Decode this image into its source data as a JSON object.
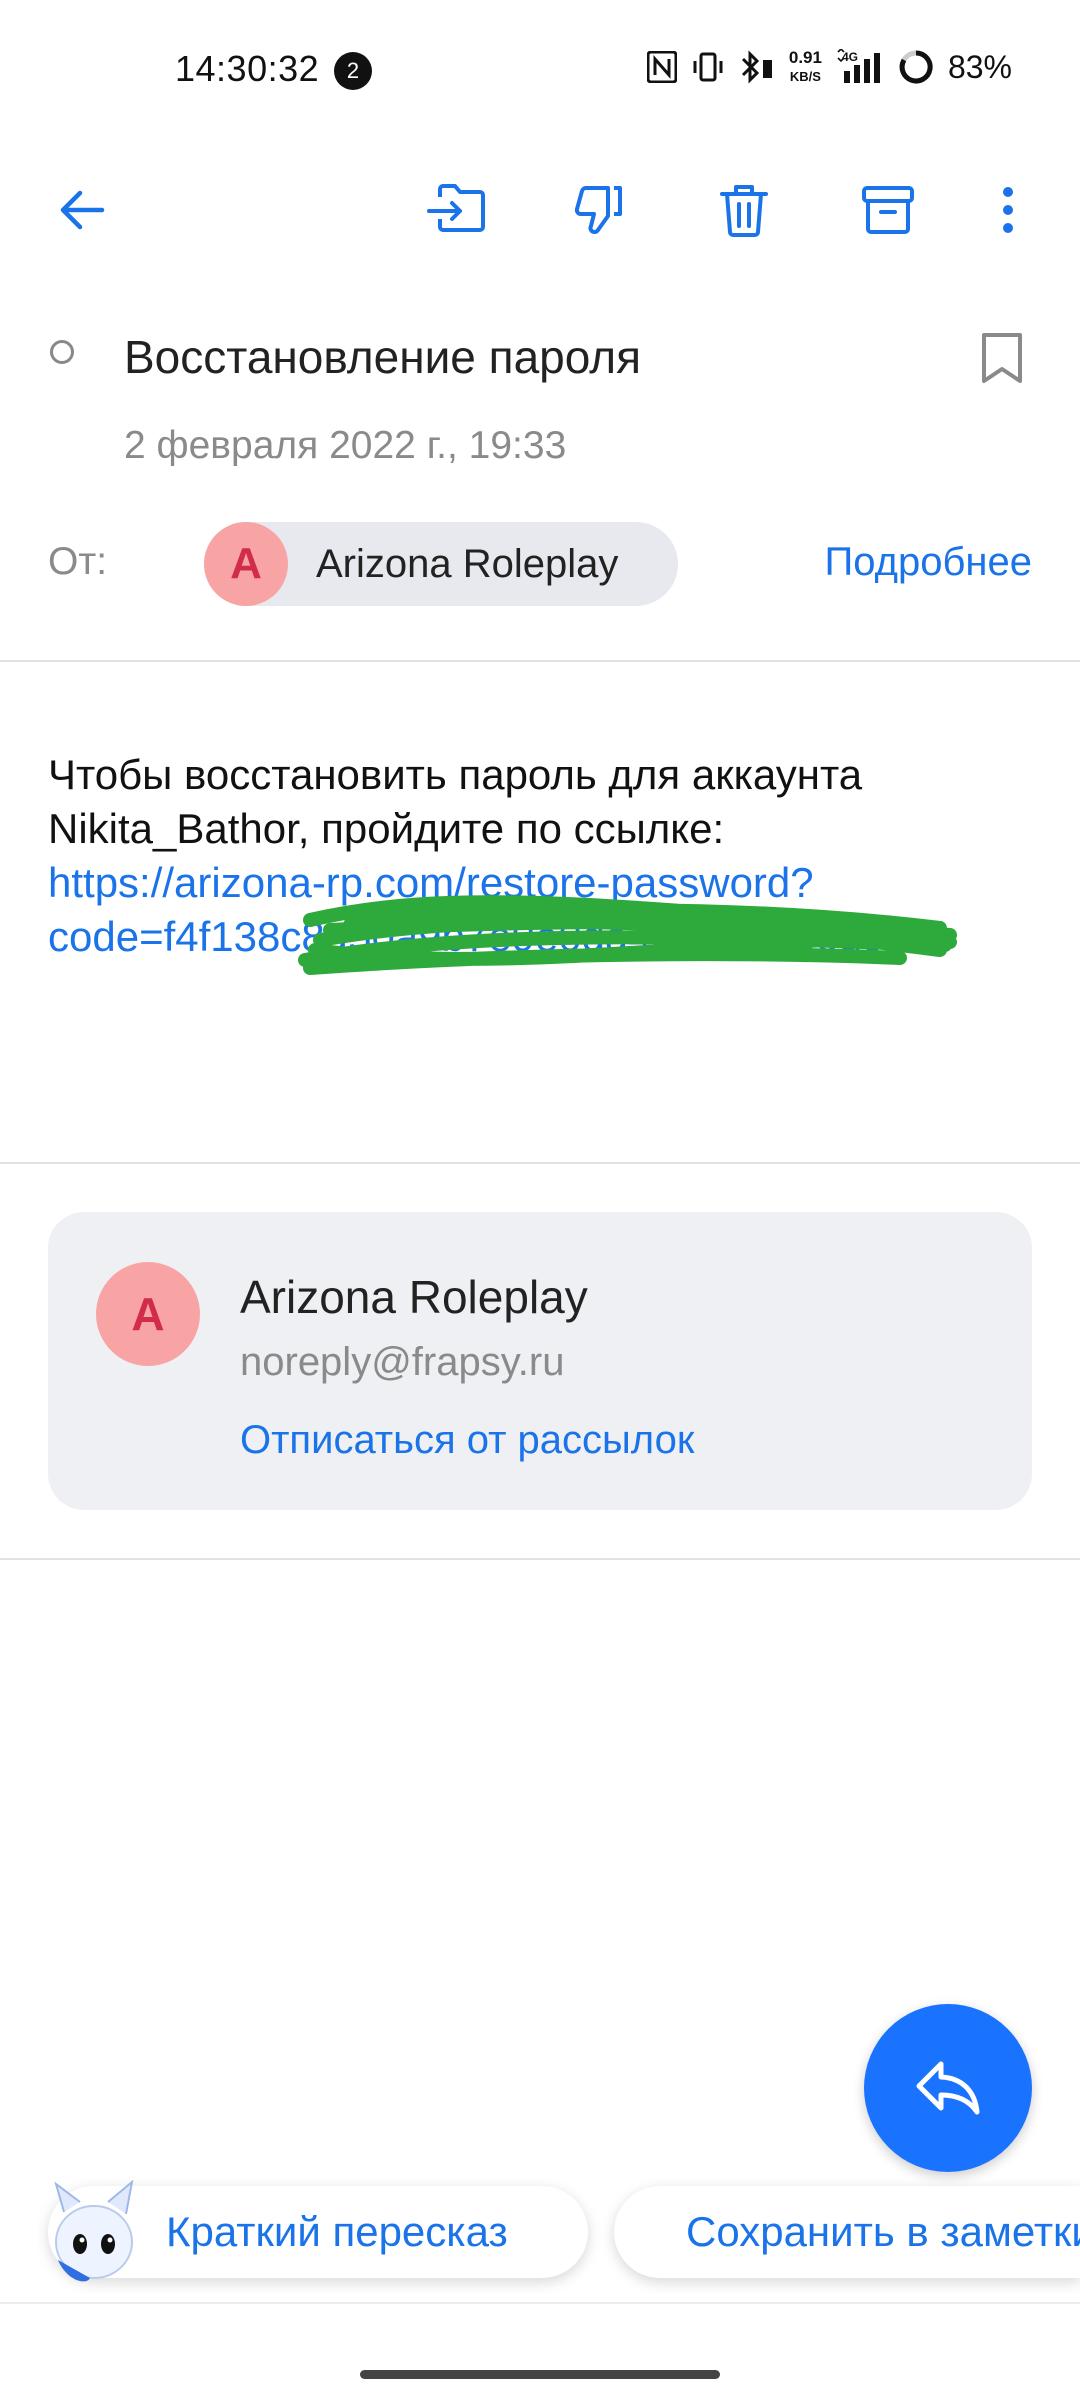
{
  "status_bar": {
    "time": "14:30:32",
    "notification_count": "2",
    "net_speed_value": "0.91",
    "net_speed_unit": "KB/S",
    "network": "4G",
    "battery": "83%"
  },
  "toolbar": {
    "icons": [
      "back-arrow-icon",
      "move-to-folder-icon",
      "thumbs-down-spam-icon",
      "trash-icon",
      "archive-icon",
      "more-vert-icon"
    ],
    "accent": "#1a73e8"
  },
  "message": {
    "subject": "Восстановление пароля",
    "date": "2 февраля 2022 г., 19:33",
    "from_label": "От:",
    "sender_initial": "A",
    "sender_name": "Arizona Roleplay",
    "details_link": "Подробнее",
    "body_line1": "Чтобы восстановить пароль для аккаунта",
    "body_line2": "Nikita_Bathor, пройдите по ссылке:",
    "link_line1": "https://arizona-rp.com/restore-password?",
    "link_line2": "code=f4f138c8a50a9b7e9e0da4e5e048b6d9d"
  },
  "contact_card": {
    "initial": "A",
    "name": "Arizona Roleplay",
    "email": "noreply@frapsy.ru",
    "unsubscribe": "Отписаться от рассылок"
  },
  "bottom_actions": {
    "summary": "Краткий пересказ",
    "save_note": "Сохранить в заметки"
  },
  "colors": {
    "link": "#1a73e8",
    "fab": "#1a73ff",
    "avatar_bg": "#f8a4a4",
    "avatar_fg": "#d22d48",
    "scribble": "#2eaa3c"
  }
}
